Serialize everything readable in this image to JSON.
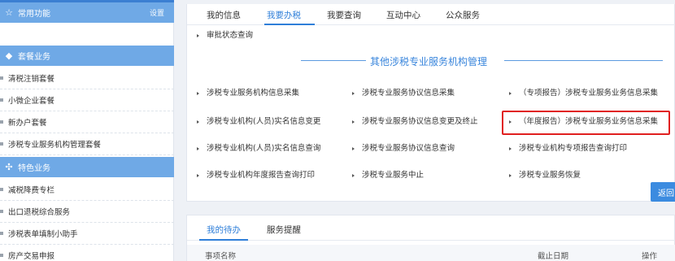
{
  "sidebar": {
    "common": {
      "title": "常用功能",
      "settings_label": "设置",
      "icon": "star-outline-icon"
    },
    "package": {
      "title": "套餐业务",
      "icon": "layers-icon",
      "items": [
        "清税注销套餐",
        "小微企业套餐",
        "新办户套餐",
        "涉税专业服务机构管理套餐"
      ]
    },
    "special": {
      "title": "特色业务",
      "icon": "clover-icon",
      "items": [
        "减税降费专栏",
        "出口退税综合服务",
        "涉税表单填制小助手",
        "房产交易申报"
      ]
    }
  },
  "main": {
    "tabs": [
      "我的信息",
      "我要办税",
      "我要查询",
      "互动中心",
      "公众服务"
    ],
    "active_tab": "我要办税",
    "top_link": "审批状态查询",
    "section_title": "其他涉税专业服务机构管理",
    "links": [
      [
        "涉税专业服务机构信息采集",
        "涉税专业服务协议信息采集",
        "（专项报告）涉税专业服务业务信息采集"
      ],
      [
        "涉税专业机构(人员)实名信息变更",
        "涉税专业服务协议信息变更及终止",
        "（年度报告）涉税专业服务业务信息采集"
      ],
      [
        "涉税专业机构(人员)实名信息查询",
        "涉税专业服务协议信息查询",
        "涉税专业机构专项报告查询打印"
      ],
      [
        "涉税专业机构年度报告查询打印",
        "涉税专业服务中止",
        "涉税专业服务恢复"
      ]
    ],
    "back_button": "返回"
  },
  "todo": {
    "tabs": [
      "我的待办",
      "服务提醒"
    ],
    "active_tab": "我的待办",
    "columns": [
      "事项名称",
      "截止日期",
      "操作"
    ]
  },
  "colors": {
    "accent": "#2f7fd9",
    "sidebar_header": "#6fa9e6",
    "highlight_border": "#e02020"
  }
}
